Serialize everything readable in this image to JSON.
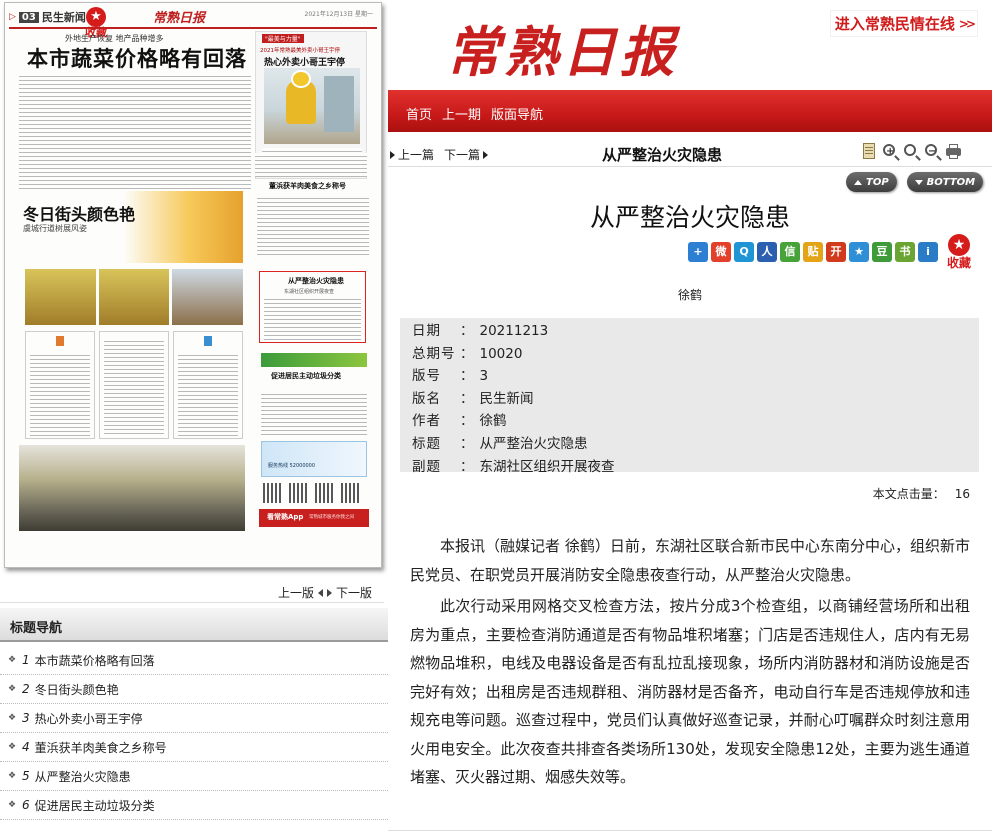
{
  "left_panel": {
    "page_number": "03",
    "section": "民生新闻",
    "favorite_label": "收藏",
    "paper_masthead": "常熟日报",
    "paper_date": "2021年12月13日 星期一",
    "lead_subtitle": "外地生产恢复 地产品种增多",
    "lead_title": "本市蔬菜价格略有回落",
    "promo_tag": "\"最美与力量\"",
    "promo_sub": "2021年常熟最美外卖小哥王宇停",
    "promo_title": "热心外卖小哥王宇停",
    "section2_title": "冬日街头颜色艳",
    "section2_sub": "虞城行道树展风姿",
    "right_col_title1": "董浜获羊肉美食之乡称号",
    "highlight_title": "从严整治火灾隐患",
    "highlight_sub": "东湖社区组织开展夜查",
    "right_col_title3": "促进居民主动垃圾分类",
    "ad_text": "服务热线 52000000",
    "app_label": "看常熟App",
    "app_sub": "常熟城市服务你我之间"
  },
  "left_pager": {
    "prev": "上一版",
    "next": "下一版"
  },
  "title_nav": {
    "heading": "标题导航",
    "items": [
      {
        "num": "1",
        "title": "本市蔬菜价格略有回落"
      },
      {
        "num": "2",
        "title": "冬日街头颜色艳"
      },
      {
        "num": "3",
        "title": "热心外卖小哥王宇停"
      },
      {
        "num": "4",
        "title": "董浜获羊肉美食之乡称号"
      },
      {
        "num": "5",
        "title": "从严整治火灾隐患"
      },
      {
        "num": "6",
        "title": "促进居民主动垃圾分类"
      }
    ]
  },
  "masthead": {
    "logo": "常熟日报",
    "enter_link": "进入常熟民情在线",
    "enter_arrows": ">>"
  },
  "red_nav": {
    "items": [
      "首页",
      "上一期",
      "版面导航"
    ]
  },
  "toolbar": {
    "prev_article": "上一篇",
    "next_article": "下一篇",
    "title": "从严整治火灾隐患",
    "icons": [
      "notebook-icon",
      "zoom-in-icon",
      "zoom-reset-icon",
      "zoom-out-icon",
      "print-icon"
    ]
  },
  "scroll_buttons": {
    "top": "TOP",
    "bottom": "BOTTOM"
  },
  "article": {
    "title": "从严整治火灾隐患",
    "author_line": "徐鹤",
    "meta": [
      {
        "key": "日期",
        "value": "20211213"
      },
      {
        "key": "总期号",
        "value": "10020"
      },
      {
        "key": "版号",
        "value": "3"
      },
      {
        "key": "版名",
        "value": "民生新闻"
      },
      {
        "key": "作者",
        "value": "徐鹤"
      },
      {
        "key": "标题",
        "value": "从严整治火灾隐患"
      },
      {
        "key": "副题",
        "value": "东湖社区组织开展夜查"
      }
    ],
    "hits_label": "本文点击量：",
    "hits_value": "16",
    "paragraphs": [
      "本报讯（融媒记者 徐鹤）日前，东湖社区联合新市民中心东南分中心，组织新市民党员、在职党员开展消防安全隐患夜查行动，从严整治火灾隐患。",
      "此次行动采用网格交叉检查方法，按片分成3个检查组，以商铺经营场所和出租房为重点，主要检查消防通道是否有物品堆积堵塞；门店是否违规住人，店内有无易燃物品堆积，电线及电器设备是否有乱拉乱接现象，场所内消防器材和消防设施是否完好有效；出租房是否违规群租、消防器材是否备齐，电动自行车是否违规停放和违规充电等问题。巡查过程中，党员们认真做好巡查记录，并耐心叮嘱群众时刻注意用火用电安全。此次夜查共排查各类场所130处，发现安全隐患12处，主要为逃生通道堵塞、灭火器过期、烟感失效等。"
    ]
  },
  "share_icons": [
    {
      "name": "add-share-icon",
      "glyph": "+",
      "color": "#2d7fd4"
    },
    {
      "name": "weibo-icon",
      "glyph": "微",
      "color": "#e2402a"
    },
    {
      "name": "qzone-icon",
      "glyph": "Q",
      "color": "#1f95d6"
    },
    {
      "name": "renren-icon",
      "glyph": "人",
      "color": "#2b5fb0"
    },
    {
      "name": "wechat-icon",
      "glyph": "信",
      "color": "#47a23a"
    },
    {
      "name": "tieba-icon",
      "glyph": "贴",
      "color": "#e3a417"
    },
    {
      "name": "kaixin-icon",
      "glyph": "开",
      "color": "#d23a1e"
    },
    {
      "name": "star-share-icon",
      "glyph": "★",
      "color": "#2e8fd6"
    },
    {
      "name": "douban-icon",
      "glyph": "豆",
      "color": "#3f9a3a"
    },
    {
      "name": "bookmark-share-icon",
      "glyph": "书",
      "color": "#6aa533"
    },
    {
      "name": "info-share-icon",
      "glyph": "i",
      "color": "#2a7cc6"
    }
  ],
  "colors": {
    "brand_red": "#c81f1f",
    "meta_bg": "#e9e9e9"
  }
}
